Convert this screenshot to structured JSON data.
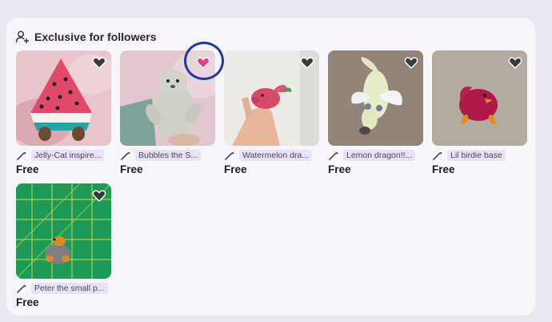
{
  "section": {
    "title": "Exclusive for followers",
    "icon": "person-plus-icon"
  },
  "colors": {
    "heart_active": "#e83e8c",
    "highlight_ring": "#1e3aa8",
    "tag_bg": "#e9e1f5"
  },
  "cards": [
    {
      "title": "Jelly-Cat inspire...",
      "price": "Free",
      "liked": false
    },
    {
      "title": "Bubbles the S...",
      "price": "Free",
      "liked": true
    },
    {
      "title": "Watermelon dra...",
      "price": "Free",
      "liked": false
    },
    {
      "title": "Lemon dragon!!...",
      "price": "Free",
      "liked": false
    },
    {
      "title": "Lil birdie base",
      "price": "Free",
      "liked": false
    },
    {
      "title": "Peter the small p...",
      "price": "Free",
      "liked": false
    }
  ]
}
